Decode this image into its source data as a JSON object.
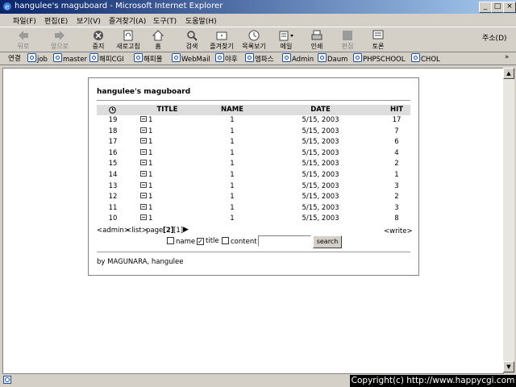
{
  "window": {
    "title": "hangulee's maguboard - Microsoft Internet Explorer",
    "controls": {
      "minimize": "_",
      "maximize": "□",
      "close": "×"
    }
  },
  "menu": [
    "파일(F)",
    "편집(E)",
    "보기(V)",
    "즐겨찾기(A)",
    "도구(T)",
    "도움말(H)"
  ],
  "toolbar": {
    "buttons": [
      "뒤로",
      "앞으로",
      "중지",
      "새로고침",
      "홈",
      "검색",
      "즐겨찾기",
      "목록보기",
      "메일",
      "인쇄",
      "편집",
      "토론"
    ],
    "address_label": "주소(D)"
  },
  "links": {
    "label": "연결",
    "items": [
      "job",
      "master",
      "해피CGI",
      "해피몰",
      "WebMail",
      "야후",
      "엠파스",
      "Admin",
      "Daum",
      "PHPSCHOOL",
      "CHOL"
    ],
    "more": "»"
  },
  "board": {
    "title": "hangulee's maguboard",
    "columns": [
      "TITLE",
      "NAME",
      "DATE",
      "HIT"
    ],
    "rows": [
      {
        "no": "19",
        "title": "1",
        "name": "1",
        "date": "5/15, 2003",
        "hit": "17"
      },
      {
        "no": "18",
        "title": "1",
        "name": "1",
        "date": "5/15, 2003",
        "hit": "7"
      },
      {
        "no": "17",
        "title": "1",
        "name": "1",
        "date": "5/15, 2003",
        "hit": "6"
      },
      {
        "no": "16",
        "title": "1",
        "name": "1",
        "date": "5/15, 2003",
        "hit": "4"
      },
      {
        "no": "15",
        "title": "1",
        "name": "1",
        "date": "5/15, 2003",
        "hit": "2"
      },
      {
        "no": "14",
        "title": "1",
        "name": "1",
        "date": "5/15, 2003",
        "hit": "1"
      },
      {
        "no": "13",
        "title": "1",
        "name": "1",
        "date": "5/15, 2003",
        "hit": "3"
      },
      {
        "no": "12",
        "title": "1",
        "name": "1",
        "date": "5/15, 2003",
        "hit": "2"
      },
      {
        "no": "11",
        "title": "1",
        "name": "1",
        "date": "5/15, 2003",
        "hit": "3"
      },
      {
        "no": "10",
        "title": "1",
        "name": "1",
        "date": "5/15, 2003",
        "hit": "8"
      }
    ],
    "nav": {
      "admin": "<admin>",
      "list": "<list>",
      "page_label": "page:",
      "current_page": "[2]",
      "other_page": "[1]",
      "next_arrow": "▶",
      "write": "<write>"
    },
    "search": {
      "options": [
        {
          "label": "name",
          "checked": false
        },
        {
          "label": "title",
          "checked": true
        },
        {
          "label": "content",
          "checked": false
        }
      ],
      "input_value": "",
      "button": "search"
    },
    "footer": "by MAGUNARA, hangulee"
  },
  "status": {
    "copyright": "Copyright(c) http://www.happycgi.com"
  },
  "colors": {
    "titlebar_start": "#0a246a",
    "titlebar_end": "#a6caf0",
    "chrome": "#d4d0c8",
    "table_header": "#dddddd"
  }
}
